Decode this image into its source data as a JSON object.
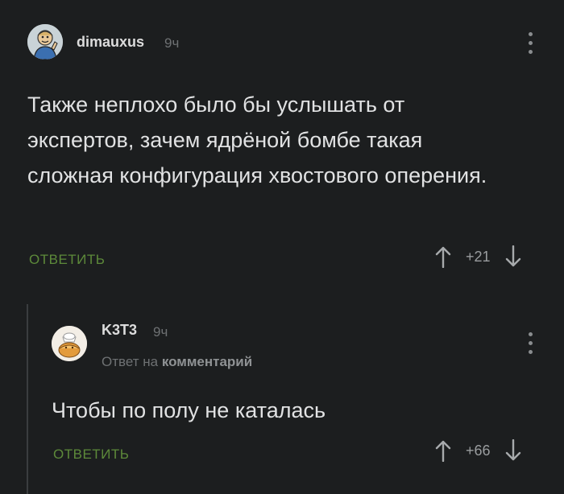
{
  "comments": [
    {
      "author": "dimauxus",
      "time": "9ч",
      "text": "Также неплохо было бы услышать от экспертов, зачем ядрёной бомбе такая сложная конфигурация хвостового оперения.",
      "reply_label": "ОТВЕТИТЬ",
      "rating": "+21"
    },
    {
      "author": "K3T3",
      "time": "9ч",
      "reply_prefix": "Ответ на",
      "reply_target": "комментарий",
      "text": "Чтобы по полу не каталась",
      "reply_label": "ОТВЕТИТЬ",
      "rating": "+66"
    }
  ],
  "colors": {
    "background": "#1c1e1f",
    "reply_button": "#5d8a3a",
    "muted": "#6e7173"
  },
  "icons": {
    "up": "arrow-up-icon",
    "down": "arrow-down-icon",
    "menu": "kebab-menu-icon"
  }
}
